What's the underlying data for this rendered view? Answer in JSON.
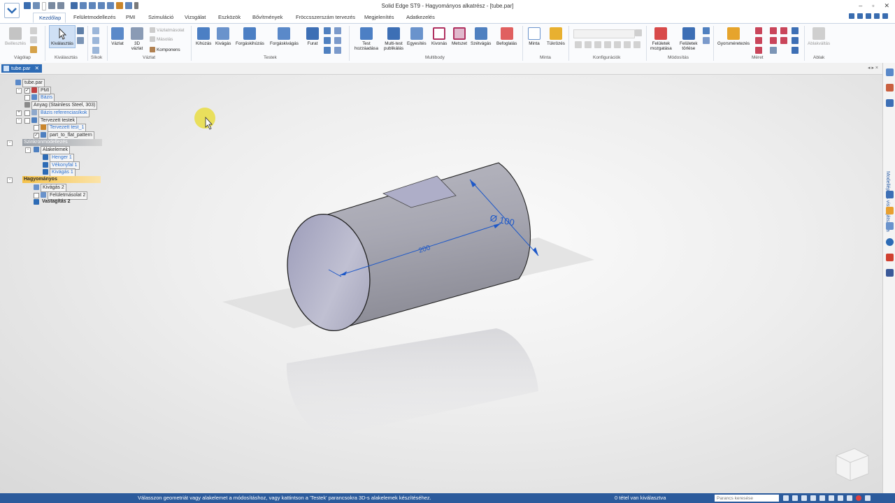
{
  "window": {
    "title": "Solid Edge ST9 - Hagyományos alkatrész - [tube.par]"
  },
  "tabs": [
    "Kezdőlap",
    "Felületmodellezés",
    "PMI",
    "Szimuláció",
    "Vizsgálat",
    "Eszközök",
    "Bővítmények",
    "Fröccsszerszám tervezés",
    "Megjelenítés",
    "Adatkezelés"
  ],
  "ribbon": {
    "clipboard": {
      "paste": "Beillesztés",
      "group": "Vágólap"
    },
    "select": {
      "select": "Kiválasztás",
      "group": "Kiválasztás"
    },
    "planes": {
      "group": "Síkok"
    },
    "sketch": {
      "sketch": "Vázlat",
      "sketch3d": "3D\nvázlat",
      "sketch_copy": "Vázlatmásolat",
      "copy": "Másolás",
      "components": "Komponens",
      "group": "Vázlat"
    },
    "solids": {
      "extrude": "Kihúzás",
      "cut": "Kivágás",
      "revolve": "Forgáskihúzás",
      "revolve_cut": "Forgáskivágás",
      "hole": "Furat",
      "group": "Testek"
    },
    "multibody": {
      "add_body": "Test\nhozzáadása",
      "publish": "Multi-test\npublikálás",
      "union": "Egyesítés",
      "subtract": "Kivonás",
      "intersect": "Metszet",
      "split": "Szétvágás",
      "enclosure": "Befoglalás",
      "group": "Multibody"
    },
    "pattern": {
      "pattern": "Minta",
      "mirror": "Tükrözés",
      "group": "Minta"
    },
    "config": {
      "group": "Konfigurációk"
    },
    "modify": {
      "move_faces": "Felületek\nmozgatása",
      "delete_faces": "Felületek\ntörlése",
      "group": "Módosítás"
    },
    "dimension": {
      "smart_dim": "Gyorsméretezés",
      "group": "Méret"
    },
    "windows": {
      "arrange": "Ablakváltás",
      "group": "Ablak"
    }
  },
  "document": {
    "tab": "tube.par",
    "close": "✕",
    "arrows": "◂ ▸ ×"
  },
  "tree": [
    {
      "label": "tube.par",
      "depth": 0,
      "style": "boxed"
    },
    {
      "label": "PMI",
      "depth": 1,
      "style": "boxed",
      "checked": true,
      "toggle": "-"
    },
    {
      "label": "Bázis",
      "depth": 1,
      "style": "boxed blue",
      "checked": false,
      "toggle": ""
    },
    {
      "label": "Anyag (Stainless Steel, 303)",
      "depth": 1,
      "style": "boxed",
      "checked": null,
      "toggle": ""
    },
    {
      "label": "Bázis referenciasíkok",
      "depth": 1,
      "style": "boxed blue",
      "checked": false,
      "toggle": "+"
    },
    {
      "label": "Tervezett testek",
      "depth": 1,
      "style": "boxed",
      "checked": false,
      "toggle": "-"
    },
    {
      "label": "Tervezett test_1",
      "depth": 2,
      "style": "boxed blue",
      "checked": false,
      "toggle": ""
    },
    {
      "label": "part_to_flat_pattern",
      "depth": 2,
      "style": "boxed",
      "checked": true,
      "toggle": ""
    },
    {
      "label": "Szinkronmodellezés",
      "depth": 0,
      "style": "section",
      "checked": null,
      "toggle": "-"
    },
    {
      "label": "Alakelemek",
      "depth": 2,
      "style": "boxed",
      "checked": null,
      "toggle": "-"
    },
    {
      "label": "Henger 1",
      "depth": 3,
      "style": "boxed blue",
      "checked": null,
      "toggle": ""
    },
    {
      "label": "Vékonyfal 1",
      "depth": 3,
      "style": "boxed blue",
      "checked": null,
      "toggle": ""
    },
    {
      "label": "Kivágás 1",
      "depth": 3,
      "style": "boxed blue",
      "checked": null,
      "toggle": ""
    },
    {
      "label": "Hagyományos",
      "depth": 0,
      "style": "highlight",
      "checked": null,
      "toggle": "-"
    },
    {
      "label": "Kivágás 2",
      "depth": 2,
      "style": "boxed",
      "checked": null,
      "toggle": ""
    },
    {
      "label": "Felületmásolat 2",
      "depth": 2,
      "style": "boxed",
      "checked": false,
      "toggle": ""
    },
    {
      "label": "Vastagítás 2",
      "depth": 2,
      "style": "bold",
      "checked": null,
      "toggle": ""
    }
  ],
  "model": {
    "length_dim": "200",
    "diameter_dim": "Ø 100"
  },
  "sidebar": {
    "panel_label": "Modellépítés visszajátszása"
  },
  "status": {
    "message": "Válasszon geometriát vagy alakelemet a módosításhoz, vagy kattintson a 'Testek' parancsokra 3D-s alakelemek készítéséhez.",
    "selection": "0 tétel van kiválasztva",
    "search_placeholder": "Parancs keresése"
  },
  "colors": {
    "accent": "#2c5b9c",
    "tab_active": "#1c4f9a",
    "tree_blue": "#2a6fcf",
    "highlight": "#f5c24a"
  }
}
